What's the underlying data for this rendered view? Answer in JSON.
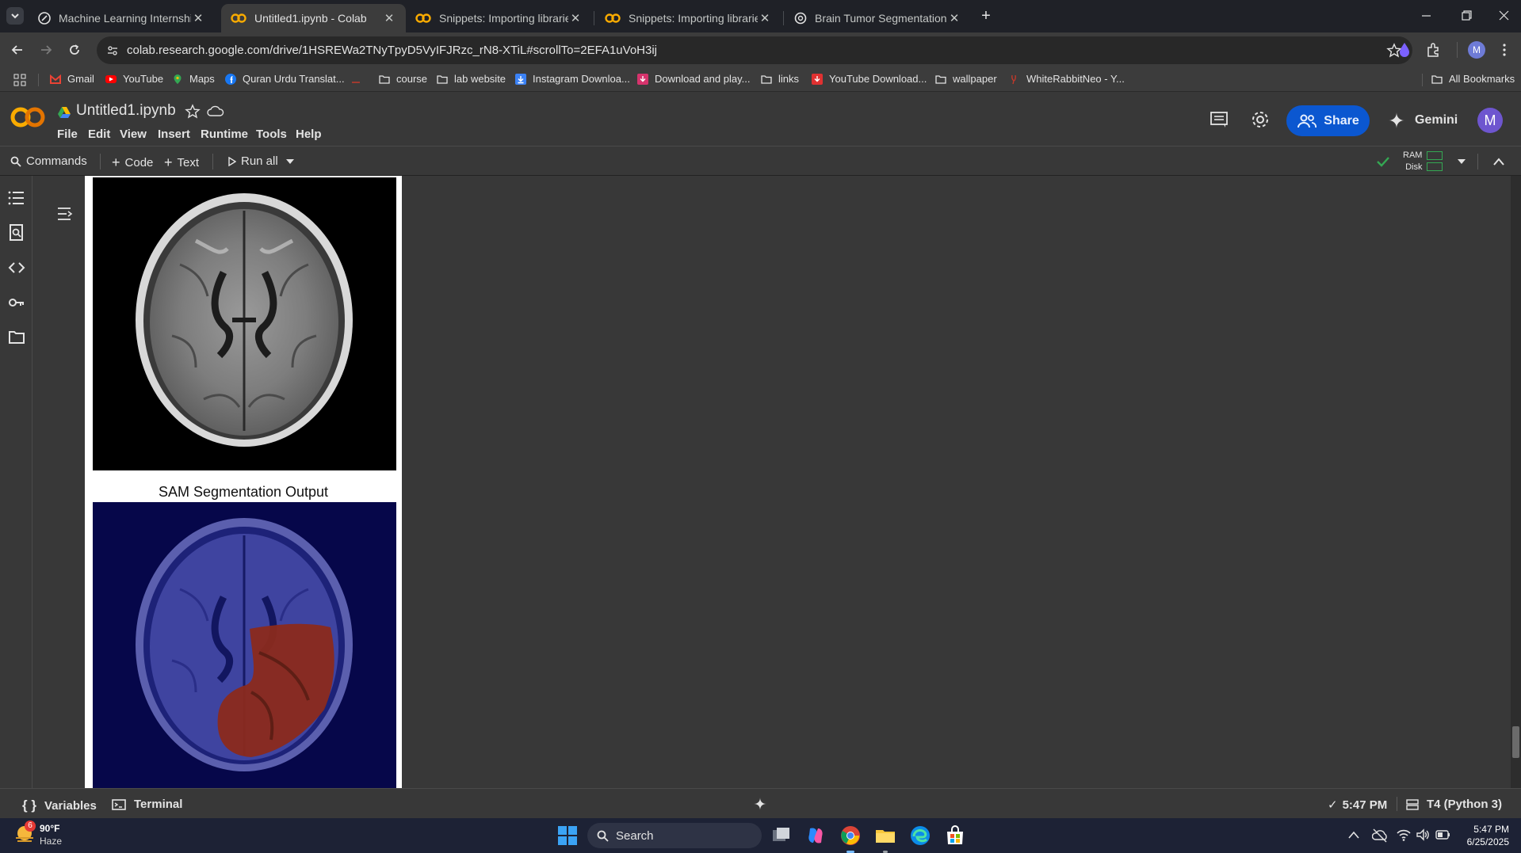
{
  "browser": {
    "tabs": [
      {
        "title": "Machine Learning Internship Gu",
        "icon": "github-icon",
        "active": false
      },
      {
        "title": "Untitled1.ipynb - Colab",
        "icon": "colab-icon",
        "active": true
      },
      {
        "title": "Snippets: Importing libraries - C",
        "icon": "colab-icon",
        "active": false
      },
      {
        "title": "Snippets: Importing libraries - C",
        "icon": "colab-icon",
        "active": false
      },
      {
        "title": "Brain Tumor Segmentation",
        "icon": "openai-icon",
        "active": false
      }
    ],
    "url": "colab.research.google.com/drive/1HSREWa2TNyTpyD5VyIFJRzc_rN8-XTiL#scrollTo=2EFA1uVoH3ij",
    "profile_initial": "M",
    "bookmarks": [
      {
        "label": "Gmail",
        "icon": "gmail-icon"
      },
      {
        "label": "YouTube",
        "icon": "youtube-icon"
      },
      {
        "label": "Maps",
        "icon": "maps-icon"
      },
      {
        "label": "Quran Urdu Translat...",
        "icon": "facebook-icon"
      },
      {
        "label": "",
        "icon": "blank-icon"
      },
      {
        "label": "course",
        "icon": "folder-icon"
      },
      {
        "label": "lab website",
        "icon": "folder-icon"
      },
      {
        "label": "Instagram Downloa...",
        "icon": "download-icon"
      },
      {
        "label": "Download and play...",
        "icon": "download-icon"
      },
      {
        "label": "links",
        "icon": "folder-icon"
      },
      {
        "label": "YouTube Download...",
        "icon": "download-icon"
      },
      {
        "label": "wallpaper",
        "icon": "folder-icon"
      },
      {
        "label": "WhiteRabbitNeo - Y...",
        "icon": "rabbit-icon"
      }
    ],
    "all_bookmarks_label": "All Bookmarks"
  },
  "colab": {
    "logo_text": "CO",
    "notebook_title": "Untitled1.ipynb",
    "menu": [
      "File",
      "Edit",
      "View",
      "Insert",
      "Runtime",
      "Tools",
      "Help"
    ],
    "share_label": "Share",
    "gemini_label": "Gemini",
    "avatar_initial": "M",
    "commands_label": "Commands",
    "code_label": "Code",
    "text_label": "Text",
    "run_all_label": "Run all",
    "ram_label": "RAM",
    "disk_label": "Disk",
    "output_title": "SAM Segmentation Output"
  },
  "statusbar": {
    "variables_label": "Variables",
    "terminal_label": "Terminal",
    "time": "5:47 PM",
    "runtime": "T4 (Python 3)"
  },
  "taskbar": {
    "weather_temp": "90°F",
    "weather_desc": "Haze",
    "weather_badge": "6",
    "search_label": "Search",
    "clock_time": "5:47 PM",
    "clock_date": "6/25/2025"
  },
  "colors": {
    "brand_orange": "#f9ab00",
    "share_bg": "#0b57d0",
    "tumor_overlay": "#8b2a1c",
    "mask_bg": "#06074a"
  }
}
